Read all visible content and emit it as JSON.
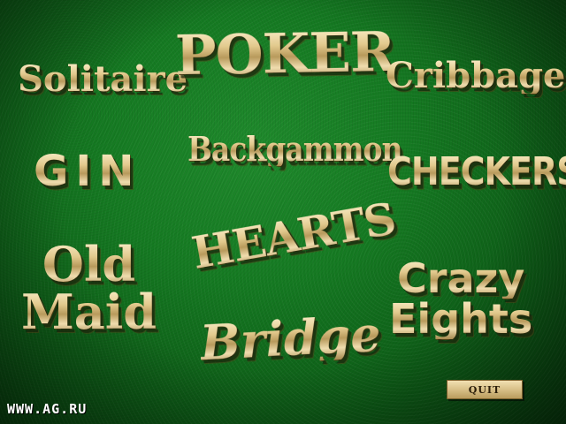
{
  "menu": {
    "games": {
      "solitaire": "Solitaire",
      "poker": "POKER",
      "cribbage": "Cribbage",
      "gin": "GIN",
      "backgammon": "Backgammon",
      "checkers": "CHECKERS",
      "old_maid_line1": "Old",
      "old_maid_line2": "Maid",
      "hearts": "HEARTS",
      "bridge": "Bridge",
      "crazy_eights_line1": "Crazy",
      "crazy_eights_line2": "Eights"
    },
    "quit_label": "QUIT"
  },
  "watermark": "WWW.AG.RU",
  "colors": {
    "felt": "#157a22",
    "felt_dark": "#083d0e",
    "gold_light": "#fbf0cc",
    "gold_mid": "#e2c98d",
    "gold_dark": "#a78a4f"
  }
}
